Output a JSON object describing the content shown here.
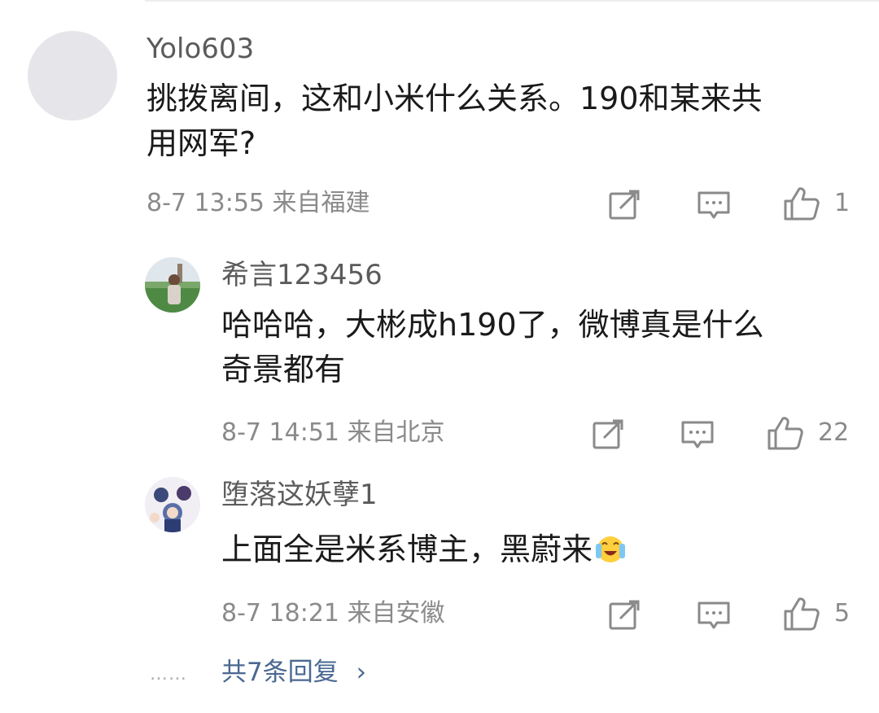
{
  "comment": {
    "username": "Yolo603",
    "content_line1": "挑拨离间，这和小米什么关系。190和某来共",
    "content_line2": "用网军?",
    "meta": "8-7 13:55 来自福建",
    "likes": "1"
  },
  "replies": [
    {
      "username": "希言123456",
      "content_line1": "哈哈哈，大彬成h190了，微博真是什么",
      "content_line2": "奇景都有",
      "meta": "8-7 14:51 来自北京",
      "likes": "22"
    },
    {
      "username": "堕落这妖孽1",
      "content_line1": "上面全是米系博主，黑蔚来",
      "emoji": "crying-laughing-emoji",
      "meta": "8-7 18:21 来自安徽",
      "likes": "5"
    }
  ],
  "more": {
    "dots": "……",
    "label": "共7条回复",
    "chevron": "›"
  },
  "icons": {
    "share": "share-icon",
    "comment": "comment-icon",
    "like": "thumbs-up-icon"
  },
  "colors": {
    "link": "#4a6891",
    "meta": "#8a8a8a",
    "username": "#5b5b5b",
    "text": "#1a1a1a"
  }
}
